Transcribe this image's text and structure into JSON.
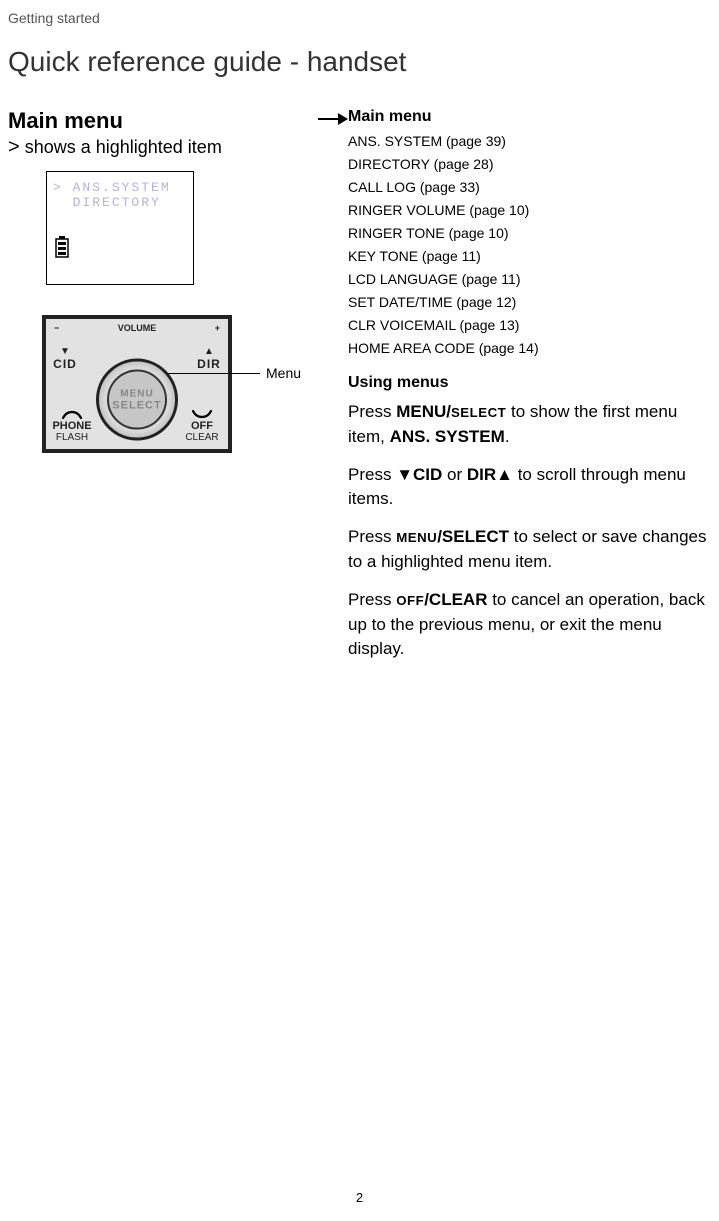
{
  "header": {
    "section": "Getting started"
  },
  "title": "Quick reference guide - handset",
  "left": {
    "main_menu_heading": "Main menu",
    "highlight_prefix": ">",
    "highlight_text": "shows a highlighted item",
    "lcd": {
      "line1_prefix": ">",
      "line1": "ANS.SYSTEM",
      "line2": "DIRECTORY"
    },
    "keypad": {
      "volume": "VOLUME",
      "minus": "−",
      "plus": "+",
      "cid_arrow": "▼",
      "cid": "CID",
      "dir_arrow": "▲",
      "dir": "DIR",
      "center_menu": "MENU",
      "center_select": "SELECT",
      "phone": "PHONE",
      "flash": "FLASH",
      "off": "OFF",
      "clear": "CLEAR"
    },
    "menu_callout": "Menu"
  },
  "right": {
    "heading": "Main menu",
    "items": [
      "ANS. SYSTEM (page 39)",
      "DIRECTORY (page 28)",
      "CALL LOG (page 33)",
      "RINGER VOLUME (page 10)",
      "RINGER TONE (page 10)",
      "KEY TONE (page 11)",
      "LCD LANGUAGE (page 11)",
      "SET DATE/TIME (page 12)",
      "CLR VOICEMAIL (page 13)",
      "HOME AREA CODE (page 14)"
    ],
    "using_heading": "Using menus",
    "p1_a": "Press ",
    "p1_b": "MENU/",
    "p1_c": "SELECT",
    "p1_d": " to show the first menu item, ",
    "p1_e": "ANS. SYSTEM",
    "p1_f": ".",
    "p2_a": "Press ",
    "p2_b": "▼",
    "p2_c": "CID",
    "p2_d": " or ",
    "p2_e": "DIR",
    "p2_f": "▲",
    "p2_g": " to scroll through menu items.",
    "p3_a": "Press ",
    "p3_b": "MENU",
    "p3_c": "/SELECT",
    "p3_d": " to select or save changes to a highlighted menu item.",
    "p4_a": "Press ",
    "p4_b": "OFF",
    "p4_c": "/CLEAR",
    "p4_d": " to cancel an operation, back up to the previous menu, or exit the menu display."
  },
  "page_number": "2"
}
